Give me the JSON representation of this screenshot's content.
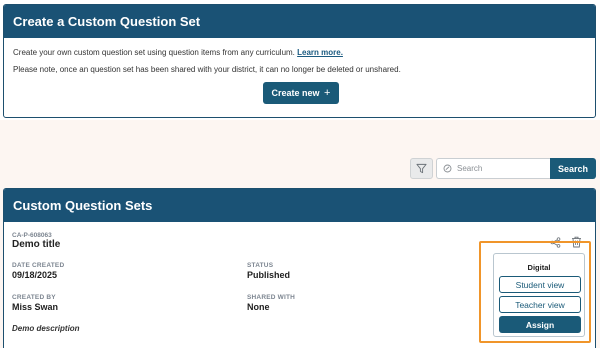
{
  "create_panel": {
    "title": "Create a Custom Question Set",
    "intro_text": "Create your own custom question set using question items from any curriculum.",
    "learn_more": "Learn more.",
    "note": "Please note, once an question set has been shared with your district, it can no longer be deleted or unshared.",
    "create_button": "Create new",
    "create_button_icon": "+"
  },
  "toolbar": {
    "filter_icon": "filter-icon",
    "search_placeholder": "Search",
    "search_button": "Search"
  },
  "sets_panel": {
    "title": "Custom Question Sets",
    "item": {
      "code": "CA-P-608063",
      "title": "Demo title",
      "date_created_label": "DATE CREATED",
      "date_created": "09/18/2025",
      "status_label": "STATUS",
      "status": "Published",
      "created_by_label": "CREATED BY",
      "created_by": "Miss Swan",
      "shared_with_label": "SHARED WITH",
      "shared_with": "None",
      "description": "Demo description",
      "actions": {
        "share_icon": "share-icon",
        "delete_icon": "trash-icon"
      },
      "digital": {
        "title": "Digital",
        "student_view": "Student view",
        "teacher_view": "Teacher view",
        "assign": "Assign"
      }
    }
  },
  "colors": {
    "header_bg": "#1a5275",
    "primary_button": "#1a5a78",
    "highlight": "#f0952a"
  }
}
